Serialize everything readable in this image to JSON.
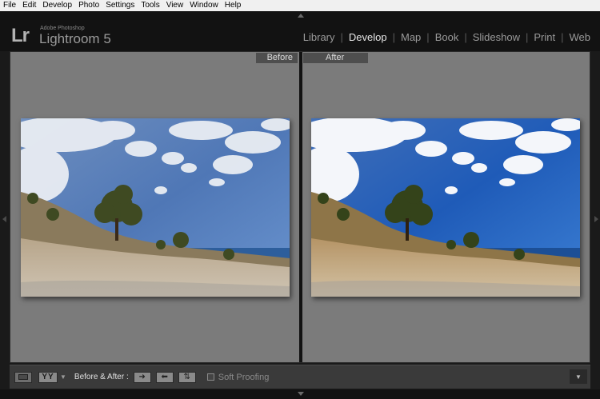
{
  "menubar": {
    "items": [
      {
        "label": "File"
      },
      {
        "label": "Edit"
      },
      {
        "label": "Develop"
      },
      {
        "label": "Photo"
      },
      {
        "label": "Settings"
      },
      {
        "label": "Tools"
      },
      {
        "label": "View"
      },
      {
        "label": "Window"
      },
      {
        "label": "Help"
      }
    ]
  },
  "identity": {
    "logo": "Lr",
    "brand_small": "Adobe Photoshop",
    "brand_big": "Lightroom 5"
  },
  "modules": [
    {
      "label": "Library"
    },
    {
      "label": "Develop",
      "active": true
    },
    {
      "label": "Map"
    },
    {
      "label": "Book"
    },
    {
      "label": "Slideshow"
    },
    {
      "label": "Print"
    },
    {
      "label": "Web"
    }
  ],
  "panes": {
    "before_label": "Before",
    "after_label": "After"
  },
  "toolbar": {
    "view_mode_label": "YY",
    "before_after_label": "Before & After :",
    "soft_proofing_label": "Soft Proofing",
    "soft_proofing_checked": false
  },
  "colors": {
    "accent_active_module": "#e6e6e6",
    "inactive_module": "#9a9a9a",
    "workspace_gray": "#7b7b7b"
  },
  "icons": {
    "loupe_view": "loupe-view-icon",
    "copy_before_to_after": "arrow-right-icon",
    "copy_after_to_before": "arrow-left-icon",
    "swap_settings": "swap-icon",
    "toolbar_menu": "chevron-down-icon"
  }
}
